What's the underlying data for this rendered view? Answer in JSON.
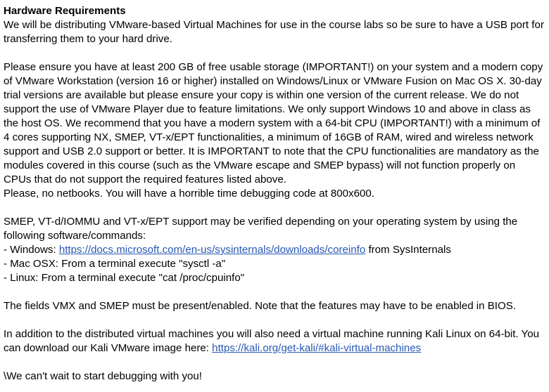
{
  "heading": "Hardware Requirements",
  "intro": "We will be distributing VMware-based Virtual Machines for use in the course labs so be sure to have a USB port for transferring them to your hard drive.",
  "requirements_paragraph": "Please ensure you have at least 200 GB of free usable storage (IMPORTANT!) on your system and a modern copy of VMware Workstation (version 16 or higher) installed on Windows/Linux or VMware Fusion on Mac OS X. 30-day trial versions are available but please ensure your copy is within one version of the current release. We do not support the use of VMware Player due to feature limitations. We only support Windows 10 and above in class as the host OS. We recommend that you have a modern system with a 64-bit CPU (IMPORTANT!) with a minimum of 4 cores supporting NX, SMEP, VT-x/EPT functionalities, a minimum of 16GB of RAM, wired and wireless network support and USB 2.0 support or better. It is IMPORTANT to note that the CPU functionalities are mandatory as the modules covered in this course (such as the VMware escape and SMEP bypass) will not function properly on CPUs that do not support the required features listed above.",
  "netbooks_note": "Please, no netbooks. You will have a horrible time debugging code at 800x600.",
  "verify_paragraph": "SMEP, VT-d/IOMMU and VT-x/EPT support may be verified depending on your operating system by using the following software/commands:",
  "commands": {
    "windows_prefix": "- Windows: ",
    "windows_link": "https://docs.microsoft.com/en-us/sysinternals/downloads/coreinfo",
    "windows_suffix": " from SysInternals",
    "mac": "- Mac OSX: From a terminal execute \"sysctl -a\"",
    "linux": "- Linux: From a terminal execute \"cat /proc/cpuinfo\""
  },
  "fields_note": "The fields VMX and SMEP must be present/enabled. Note that the features may have to be enabled in BIOS.",
  "kali_paragraph": "In addition to the distributed virtual machines you will also need a virtual machine running Kali Linux on 64-bit. You can download our Kali VMware image here: ",
  "kali_link": "https://kali.org/get-kali/#kali-virtual-machines",
  "closing": "\\We can't wait to start debugging with you!",
  "colors": {
    "text": "#000000",
    "link": "#2758b6",
    "background": "#ffffff"
  }
}
